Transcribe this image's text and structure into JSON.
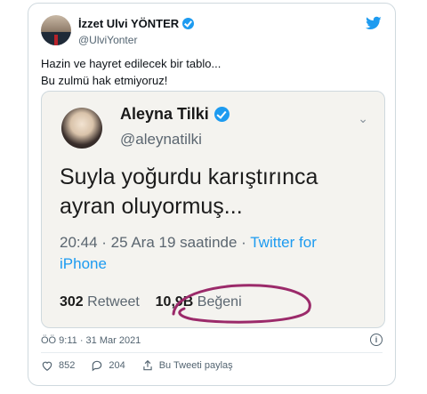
{
  "tweet": {
    "author_name": "İzzet Ulvi YÖNTER",
    "author_handle": "@UlviYonter",
    "text_line1": "Hazin ve hayret edilecek bir tablo...",
    "text_line2": "Bu zulmü hak etmiyoruz!",
    "timestamp": "ÖÖ 9:11 · 31 Mar 2021",
    "like_count": "852",
    "reply_count": "204",
    "share_label": "Bu Tweeti paylaş"
  },
  "embedded": {
    "name": "Aleyna Tilki",
    "handle": "@aleynatilki",
    "text_line1": "Suyla yoğurdu karıştırınca",
    "text_line2": "ayran oluyormuş...",
    "meta": "20:44 · 25 Ara 19 saatinde · ",
    "source": "Twitter for iPhone",
    "retweet_count": "302",
    "retweet_label": "Retweet",
    "like_count": "10,9B",
    "like_label": "Beğeni"
  },
  "colors": {
    "accent": "#1d9bf0",
    "secondary_text": "#536471",
    "scribble": "#9b2a6a"
  }
}
